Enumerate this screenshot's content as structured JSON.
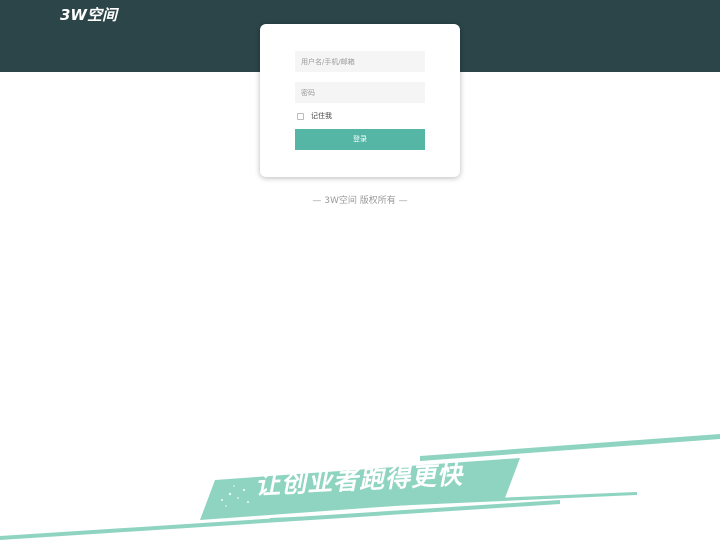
{
  "header": {
    "logo_text": "3W空间"
  },
  "login_form": {
    "username_placeholder": "用户名/手机/邮箱",
    "password_placeholder": "密码",
    "remember_label": "记住我",
    "remember_checked": false,
    "submit_label": "登录"
  },
  "footer": {
    "copyright": "— 3W空间 版权所有 —"
  },
  "banner": {
    "slogan": "让创业者跑得更快"
  },
  "colors": {
    "header_bg": "#2b4549",
    "accent": "#55b6a6",
    "slogan_band": "#8fd4c1"
  }
}
